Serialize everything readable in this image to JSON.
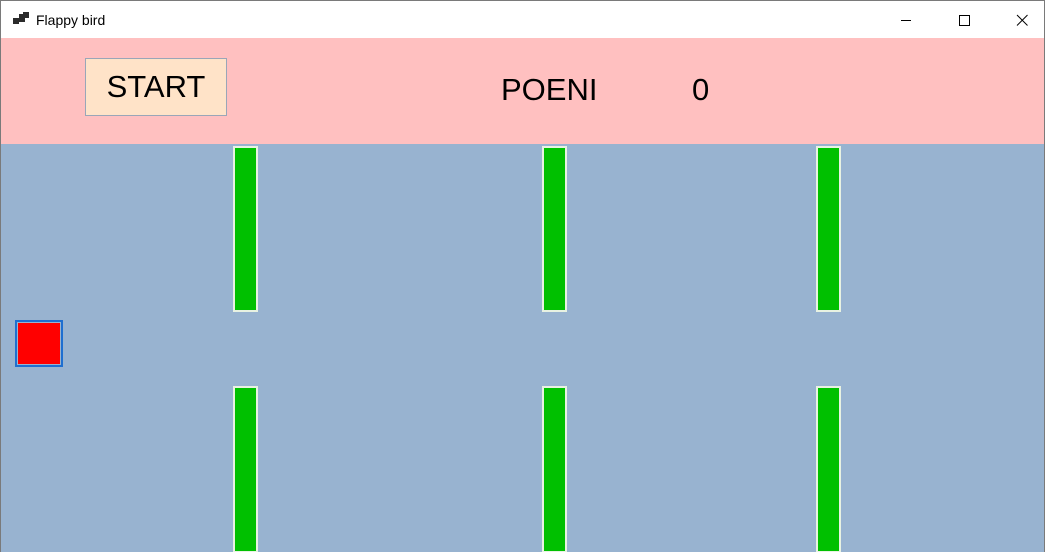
{
  "window": {
    "title": "Flappy bird",
    "icon": "app-window-icon",
    "controls": {
      "minimize_icon": "minimize-icon",
      "maximize_icon": "maximize-icon",
      "close_icon": "close-icon"
    }
  },
  "header": {
    "start_label": "START",
    "score_label": "POENI",
    "score_value": "0",
    "background_color": "#ffc0c0",
    "start_button_color": "#ffe3c8"
  },
  "game": {
    "background_color": "#98b3d0",
    "pipe_color": "#00c000",
    "bird_color": "#ff0000",
    "pipe_pairs": 3
  }
}
